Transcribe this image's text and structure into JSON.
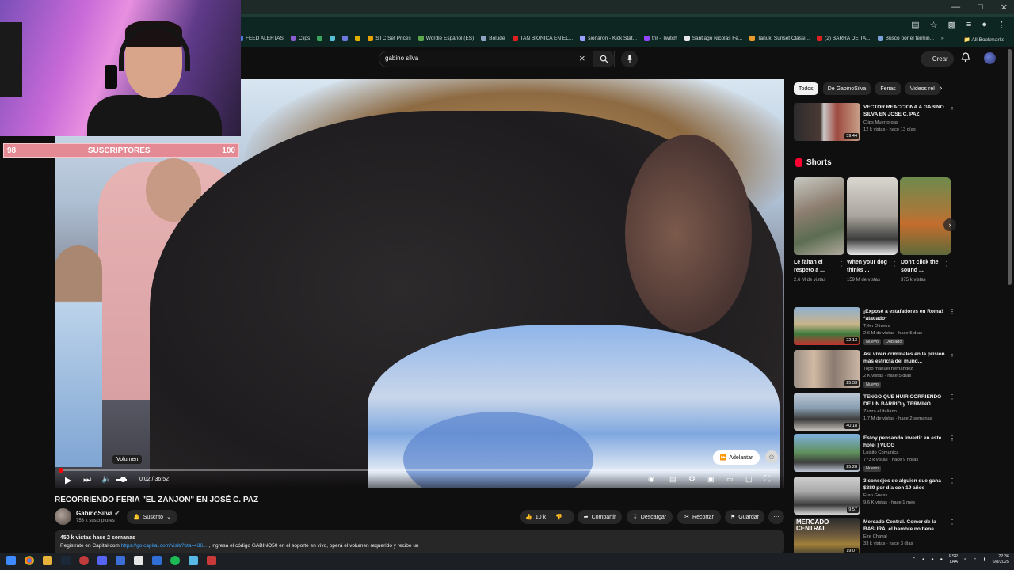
{
  "browser": {
    "bookmarks": [
      {
        "label": "FEED ALERTAS",
        "color": "#4a7ad9"
      },
      {
        "label": "Clips",
        "color": "#8a5cd0"
      },
      {
        "label": "",
        "color": "#3ba55d"
      },
      {
        "label": "",
        "color": "#56c1d6"
      },
      {
        "label": "",
        "color": "#6c7ae0"
      },
      {
        "label": "",
        "color": "#e0b000"
      },
      {
        "label": "STC Set Prices",
        "color": "#e7a100"
      },
      {
        "label": "Wordle Español (ES)",
        "color": "#5aa84a"
      },
      {
        "label": "Bolude",
        "color": "#8da3c0"
      },
      {
        "label": "TAN BIONICA EN EL...",
        "color": "#e02020"
      },
      {
        "label": "sionaron - Kick Stat...",
        "color": "#9aa0ff"
      },
      {
        "label": "tnr - Twitch",
        "color": "#9146ff"
      },
      {
        "label": "Santiago Nicolas Fe...",
        "color": "#e6e6e6"
      },
      {
        "label": "Tanuki Sunset Classi...",
        "color": "#e89a2c"
      },
      {
        "label": "(2) BARRA DE TA...",
        "color": "#e02020"
      },
      {
        "label": "Buscó por el termin...",
        "color": "#7aa0d8"
      }
    ],
    "more_bookmarks": "»",
    "all_bookmarks": "All Bookmarks"
  },
  "youtube": {
    "search_value": "gabino silva",
    "create_label": "Crear"
  },
  "overlay": {
    "sub_current": "98",
    "sub_label": "SUSCRIPTORES",
    "sub_goal": "100"
  },
  "player": {
    "tooltip": "Volumen",
    "time_current": "0:02",
    "time_sep": " / ",
    "time_total": "36:52",
    "skip_label": "Adelantar",
    "progress_fraction": 0.001
  },
  "video": {
    "title": "RECORRIENDO FERIA \"EL ZANJON\" EN JOSÉ C. PAZ",
    "channel": "GabinoSilva",
    "subscribers": "753 k suscriptores",
    "subscribed_label": "Suscrito",
    "likes": "10 k",
    "share_label": "Compartir",
    "download_label": "Descargar",
    "clip_label": "Recortar",
    "save_label": "Guardar",
    "desc_meta": "450 k vistas  hace 2 semanas",
    "desc_prefix": "Registrate en Capital.com ",
    "desc_link": "https://go.capital.com/visit/?bta=436...",
    "desc_suffix": " , ingresá el código GABINO50 en el soporte en vivo, operá el volumen requerido y recibe un"
  },
  "sidebar": {
    "chips": [
      "Todos",
      "De GabinoSilva",
      "Ferias",
      "Videos rel"
    ],
    "top_rec": {
      "title": "VECTOR REACCIONA A GABINO SILVA EN JOSE C. PAZ",
      "channel": "Clips Muertorgas",
      "meta": "12 k vistas · hace 13 días",
      "duration": "39:44"
    },
    "shorts_title": "Shorts",
    "shorts": [
      {
        "title": "Le faltan el respeto a ...",
        "views": "2.6 M de vistas"
      },
      {
        "title": "When your dog thinks ...",
        "views": "159 M de vistas"
      },
      {
        "title": "Don't click the sound ...",
        "views": "375 k vistas"
      }
    ],
    "recs": [
      {
        "title": "¡Exposé a estafadores en Roma! *atacado*",
        "channel": "Tyler Oliveira",
        "meta": "2.6 M de vistas · hace 5 días",
        "duration": "22:13",
        "badges": [
          "Nuevo",
          "Doblado"
        ]
      },
      {
        "title": "Así viven criminales en la prisión más estricta del mund...",
        "channel": "Topo manuel hernandez",
        "meta": "2 K vistas · hace 5 días",
        "duration": "25:33",
        "badges": [
          "Nuevo"
        ]
      },
      {
        "title": "TENGO QUE HUIR CORRIENDO DE UN BARRIO y TERMINO ...",
        "channel": "Zazza el italiano",
        "meta": "1.7 M de vistas · hace 2 semanas",
        "duration": "40:18",
        "badges": []
      },
      {
        "title": "Estoy pensando invertir en este hotel | VLOG",
        "channel": "Luisito Comunica",
        "meta": "773 k vistas · hace 9 horas",
        "duration": "25:28",
        "badges": [
          "Nuevo"
        ]
      },
      {
        "title": "3 consejos de alguien que gana $389 por día con 19 años",
        "channel": "Fran Guess",
        "meta": "9.6 K vistas · hace 1 mes",
        "duration": "9:57",
        "badges": []
      },
      {
        "title": "Mercado Central. Comer de la BASURA, el hambre no tiene ...",
        "channel": "Eze Chaval",
        "meta": "33 k vistas · hace 3 días",
        "duration": "19:07",
        "badges": []
      }
    ],
    "thumb_text": "MERCADO CENTRAL"
  },
  "taskbar": {
    "lang": "ESP",
    "lang2": "LAA",
    "time": "22:36",
    "date": "6/8/2025"
  }
}
